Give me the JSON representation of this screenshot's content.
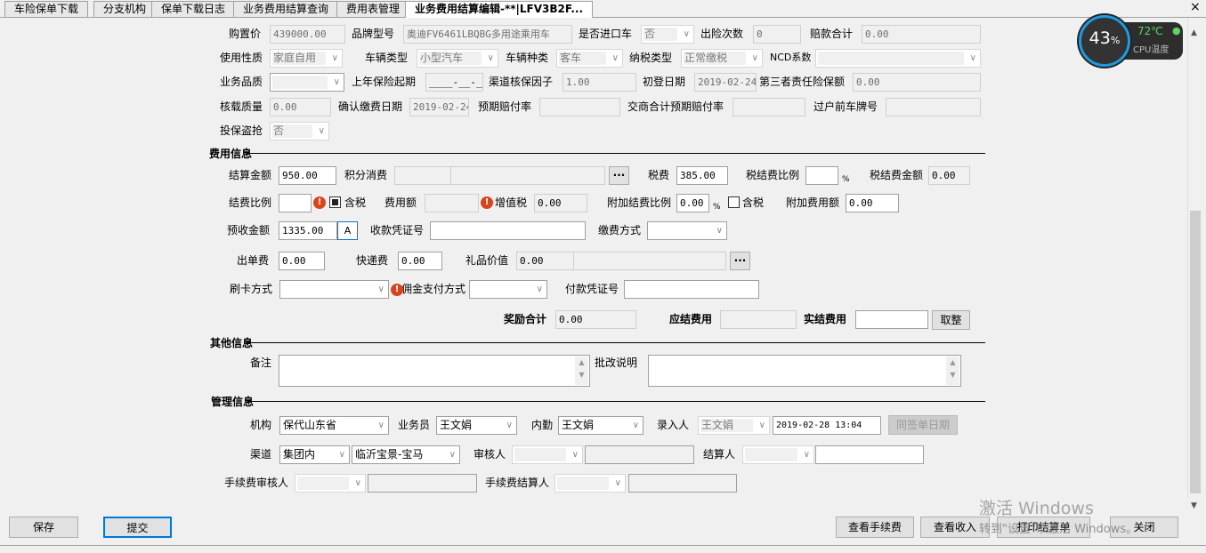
{
  "tabs": [
    "车险保单下载",
    "分支机构",
    "保单下载日志",
    "业务费用结算查询",
    "费用表管理",
    "业务费用结算编辑-**|LFV3B2F..."
  ],
  "close_tab": "×",
  "vehicle": {
    "purchase_price_label": "购置价",
    "purchase_price": "439000.00",
    "brand_label": "品牌型号",
    "brand": "奥迪FV6461LBQBG多用途乘用车",
    "imported_label": "是否进口车",
    "imported": "否",
    "claims_count_label": "出险次数",
    "claims_count": "0",
    "claims_total_label": "赔款合计",
    "claims_total": "0.00",
    "usage_label": "使用性质",
    "usage": "家庭自用",
    "vehicle_type_label": "车辆类型",
    "vehicle_type": "小型汽车",
    "vehicle_kind_label": "车辆种类",
    "vehicle_kind": "客车",
    "tax_type_label": "纳税类型",
    "tax_type": "正常缴税",
    "ncd_label": "NCD系数",
    "ncd": "",
    "quality_label": "业务品质",
    "quality": "",
    "last_start_label": "上年保险起期",
    "last_start": "____-__-__",
    "channel_factor_label": "渠道核保因子",
    "channel_factor": "1.00",
    "first_reg_label": "初登日期",
    "first_reg": "2019-02-24",
    "third_party_label": "第三者责任险保额",
    "third_party": "0.00",
    "load_label": "核载质量",
    "load": "0.00",
    "confirm_date_label": "确认缴费日期",
    "confirm_date": "2019-02-24",
    "expected_rate_label": "预期赔付率",
    "expected_rate": "",
    "combined_rate_label": "交商合计预期赔付率",
    "combined_rate": "",
    "prev_plate_label": "过户前车牌号",
    "prev_plate": "",
    "theft_label": "投保盗抢",
    "theft": "否"
  },
  "fee": {
    "section": "费用信息",
    "settle_amount_label": "结算金额",
    "settle_amount": "950.00",
    "points_label": "积分消费",
    "points": "",
    "ellipsis": "···",
    "tax_label": "税费",
    "tax": "385.00",
    "tax_ratio_label": "税结费比例",
    "tax_ratio": "",
    "percent": "%",
    "tax_amount_label": "税结费金额",
    "tax_amount": "0.00",
    "fee_ratio_label": "结费比例",
    "fee_ratio": "",
    "warn": "!",
    "incl_tax_label": "含税",
    "fee_amount_label": "费用额",
    "fee_amount": "",
    "vat_label": "增值税",
    "vat": "0.00",
    "extra_ratio_label": "附加结费比例",
    "extra_ratio": "0.00",
    "extra_amount_label": "附加费用额",
    "extra_amount": "0.00",
    "prepaid_label": "预收金额",
    "prepaid": "1335.00",
    "a_btn": "A",
    "receipt_label": "收款凭证号",
    "receipt": "",
    "pay_method_label": "缴费方式",
    "pay_method": "",
    "issue_fee_label": "出单费",
    "issue_fee": "0.00",
    "courier_label": "快递费",
    "courier": "0.00",
    "gift_label": "礼品价值",
    "gift": "0.00",
    "card_label": "刷卡方式",
    "card": "",
    "commission_label": "佣金支付方式",
    "commission": "",
    "pay_voucher_label": "付款凭证号",
    "pay_voucher": "",
    "reward_label": "奖励合计",
    "reward": "0.00",
    "due_label": "应结费用",
    "due": "",
    "actual_label": "实结费用",
    "actual": "",
    "round_btn": "取整"
  },
  "other": {
    "section": "其他信息",
    "remark_label": "备注",
    "remark": "",
    "endorse_label": "批改说明",
    "endorse": ""
  },
  "mgmt": {
    "section": "管理信息",
    "org_label": "机构",
    "org": "保代山东省",
    "sales_label": "业务员",
    "sales": "王文娟",
    "staff_label": "内勤",
    "staff": "王文娟",
    "entry_label": "录入人",
    "entry": "王文娟",
    "entry_time": "2019-02-28 13:04",
    "same_date_btn": "同签单日期",
    "channel_label": "渠道",
    "channel": "集团内",
    "channel_sub": "临沂宝景-宝马",
    "auditor_label": "审核人",
    "settler_label": "结算人",
    "fee_auditor_label": "手续费审核人",
    "fee_settler_label": "手续费结算人"
  },
  "buttons": {
    "save": "保存",
    "submit": "提交",
    "view_fee": "查看手续费",
    "view_income": "查看收入",
    "print": "打印结算单",
    "close": "关闭"
  },
  "cpu": {
    "percent": "43",
    "unit": "%",
    "temp": "72℃",
    "label": "CPU温度"
  },
  "watermark": {
    "line1": "激活 Windows",
    "line2": "转到\"设置\"以激活 Windows。"
  }
}
